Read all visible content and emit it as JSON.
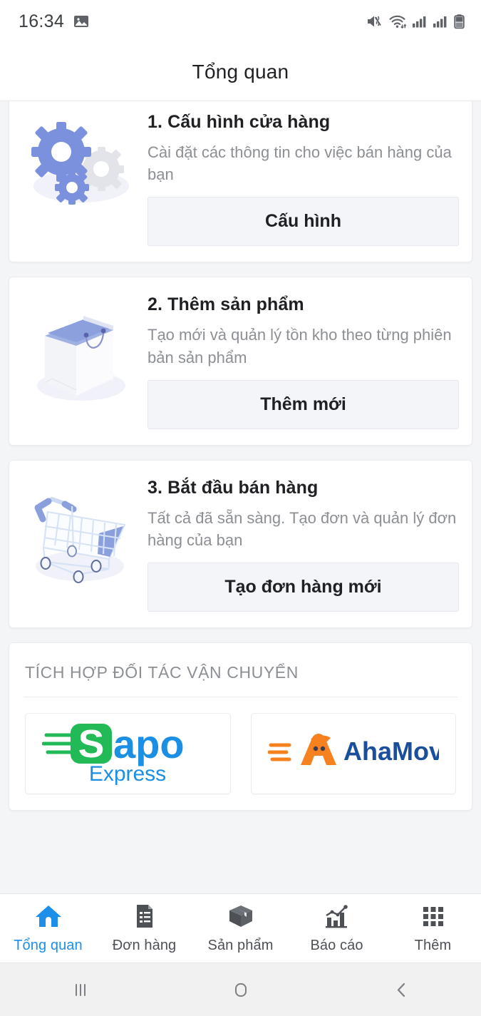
{
  "status_bar": {
    "clock": "16:34",
    "left_icons": [
      "image-icon"
    ],
    "right_icons": [
      "mute-vibrate-icon",
      "wifi-icon",
      "signal-bars-1-icon",
      "signal-bars-2-icon",
      "battery-icon"
    ]
  },
  "header": {
    "title": "Tổng quan"
  },
  "steps": [
    {
      "art": "gears-illustration",
      "title": "1. Cấu hình cửa hàng",
      "description": "Cài đặt các thông tin cho việc bán hàng của bạn",
      "button_label": "Cấu hình"
    },
    {
      "art": "shopping-bag-illustration",
      "title": "2. Thêm sản phẩm",
      "description": "Tạo mới và quản lý tồn kho theo từng phiên bản sản phẩm",
      "button_label": "Thêm mới"
    },
    {
      "art": "shopping-cart-illustration",
      "title": "3. Bắt đầu bán hàng",
      "description": "Tất cả đã sẵn sàng. Tạo đơn và quản lý đơn hàng của bạn",
      "button_label": "Tạo đơn hàng mới"
    }
  ],
  "partners": {
    "section_title": "TÍCH HỢP ĐỐI TÁC VẬN CHUYỂN",
    "items": [
      {
        "name": "Sapo",
        "sub": "Express",
        "logo": "sapo-express-logo"
      },
      {
        "name": "AhaMove",
        "sub": "",
        "logo": "ahamove-logo"
      }
    ]
  },
  "bottom_nav": {
    "items": [
      {
        "label": "Tổng quan",
        "icon": "home-icon",
        "active": true
      },
      {
        "label": "Đơn hàng",
        "icon": "order-document-icon",
        "active": false
      },
      {
        "label": "Sản phẩm",
        "icon": "box-icon",
        "active": false
      },
      {
        "label": "Báo cáo",
        "icon": "bar-chart-icon",
        "active": false
      },
      {
        "label": "Thêm",
        "icon": "grid-more-icon",
        "active": false
      }
    ]
  },
  "android_nav": {
    "buttons": [
      "recents-icon",
      "home-circle-icon",
      "back-chevron-icon"
    ]
  },
  "colors": {
    "page_background": "#f4f5f7",
    "card_background": "#ffffff",
    "accent_blue": "#1e8fe8",
    "title_text": "#1f2023",
    "muted_text": "#8c8f94",
    "button_background": "#f4f5f9",
    "illustration_periwinkle": "#7c91dd",
    "sapo_green": "#22b957",
    "sapo_blue": "#1a8fe3",
    "ahamove_orange": "#f5821f",
    "ahamove_blue": "#1b4f9c"
  }
}
